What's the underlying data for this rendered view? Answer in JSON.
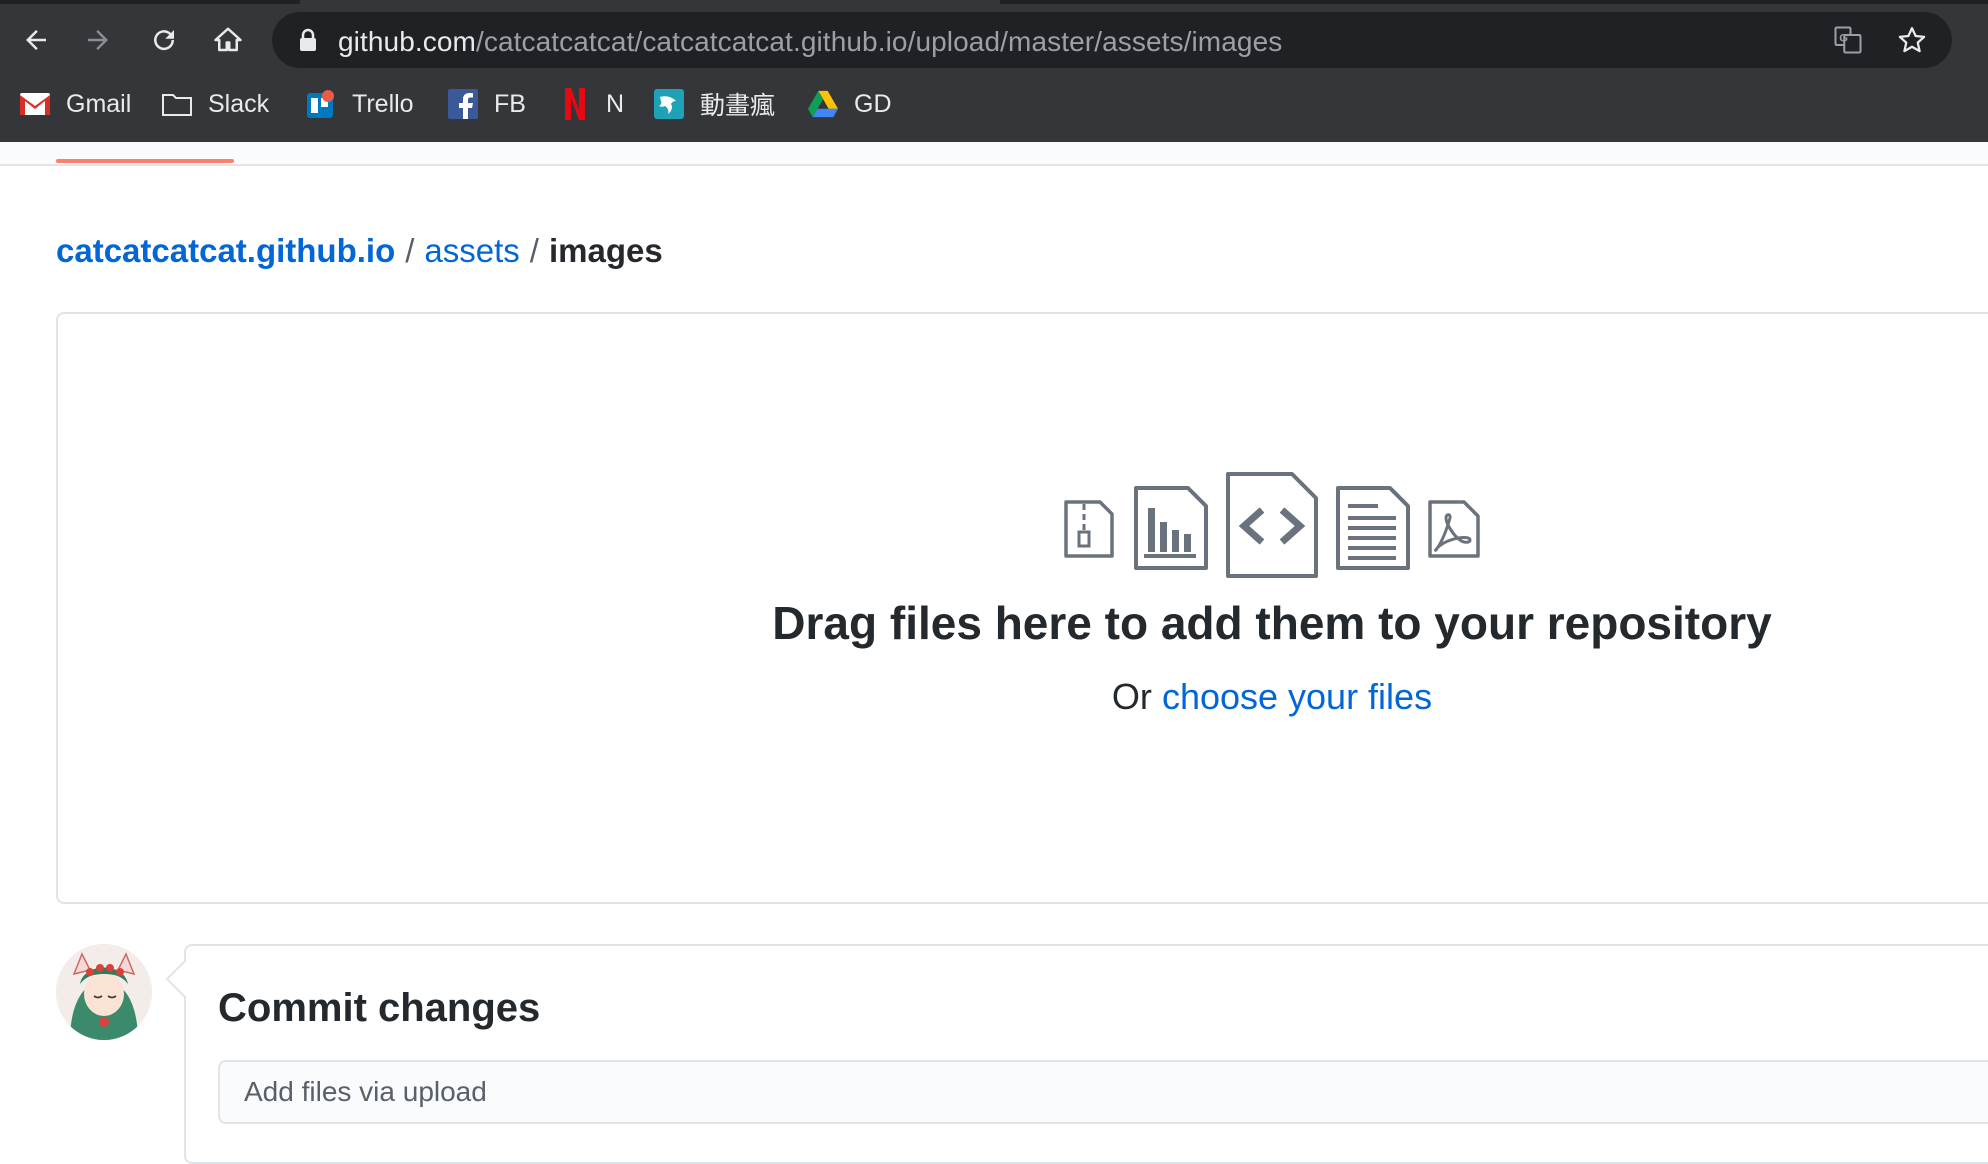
{
  "browser": {
    "url_host": "github.com",
    "url_path": "/catcatcatcat/catcatcatcat.github.io/upload/master/assets/images",
    "bookmarks": [
      {
        "label": "Gmail",
        "icon": "gmail-icon"
      },
      {
        "label": "Slack",
        "icon": "folder-icon"
      },
      {
        "label": "Trello",
        "icon": "trello-icon"
      },
      {
        "label": "FB",
        "icon": "facebook-icon"
      },
      {
        "label": "N",
        "icon": "netflix-icon"
      },
      {
        "label": "動畫瘋",
        "icon": "anime-icon"
      },
      {
        "label": "GD",
        "icon": "google-drive-icon"
      }
    ]
  },
  "breadcrumb": {
    "repo": "catcatcatcat.github.io",
    "folder": "assets",
    "current": "images",
    "separator": "/"
  },
  "dropzone": {
    "title": "Drag files here to add them to your repository",
    "or_text": "Or",
    "choose_link": "choose your files",
    "icons": [
      "file-zip-icon",
      "file-chart-icon",
      "file-code-icon",
      "file-text-icon",
      "file-pdf-icon"
    ]
  },
  "commit": {
    "title": "Commit changes",
    "placeholder": "Add files via upload"
  },
  "colors": {
    "link": "#0366d6",
    "text": "#24292e",
    "chrome_bg": "#35363a",
    "tab_underline": "#f9826c"
  }
}
